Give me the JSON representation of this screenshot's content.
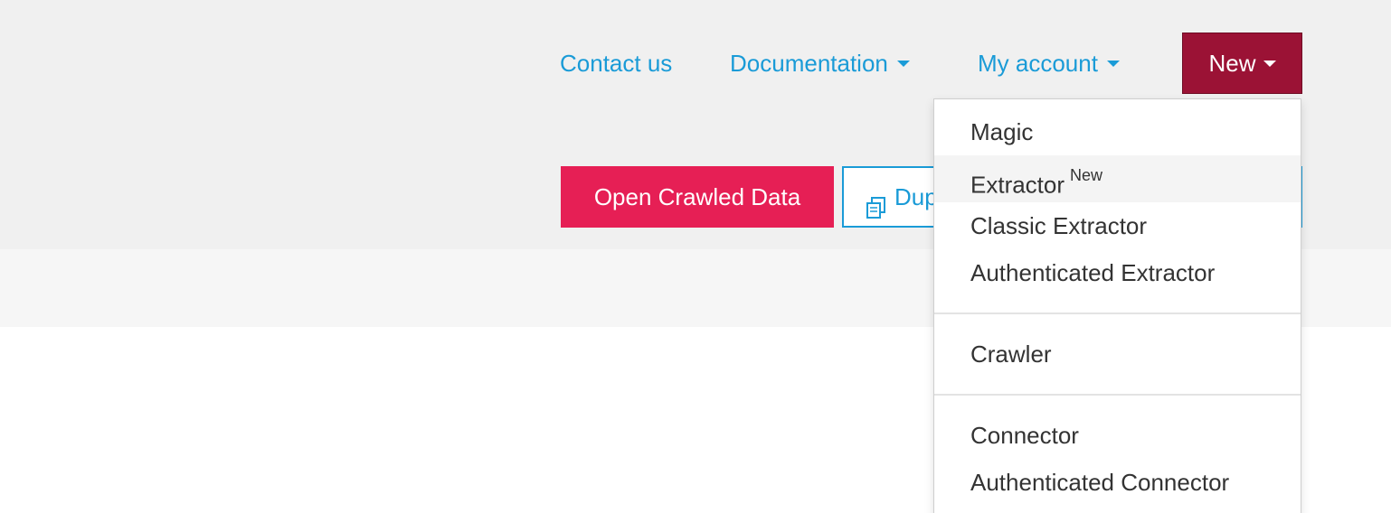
{
  "colors": {
    "link": "#1a9bd7",
    "new_button": "#9b1235",
    "primary_button": "#e61f55",
    "menu_text": "#333333"
  },
  "nav": {
    "contact": "Contact us",
    "documentation": "Documentation",
    "account": "My account",
    "new": "New"
  },
  "actions": {
    "open_crawled": "Open Crawled Data",
    "duplicate": "Duplicate"
  },
  "new_menu": {
    "items": [
      {
        "label": "Magic"
      },
      {
        "label": "Extractor",
        "badge": "New"
      },
      {
        "label": "Classic Extractor"
      },
      {
        "label": "Authenticated Extractor"
      },
      {
        "label": "Crawler"
      },
      {
        "label": "Connector"
      },
      {
        "label": "Authenticated Connector"
      }
    ]
  }
}
